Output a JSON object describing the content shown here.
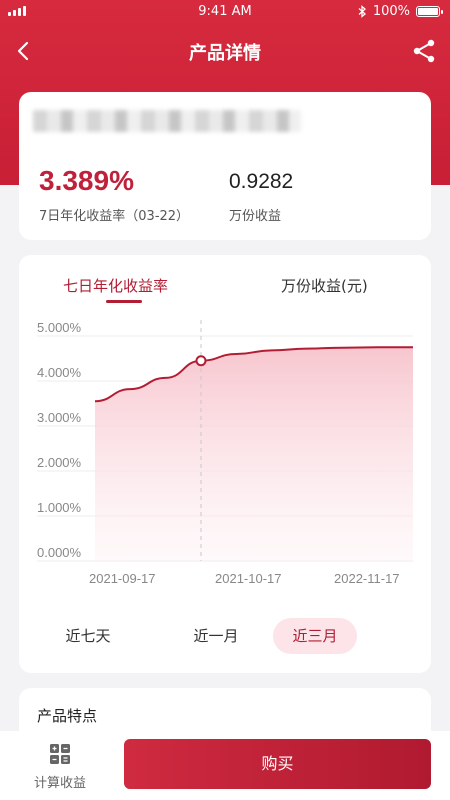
{
  "status_bar": {
    "time": "9:41 AM",
    "battery": "100%"
  },
  "nav": {
    "title": "产品详情"
  },
  "product": {
    "yield_value": "3.389%",
    "yield_label": "7日年化收益率（03-22）",
    "wan_value": "0.9282",
    "wan_label": "万份收益"
  },
  "tabs": [
    {
      "label": "七日年化收益率",
      "active": true
    },
    {
      "label": "万份收益(元)",
      "active": false
    }
  ],
  "chart_data": {
    "type": "area",
    "x_tick_labels": [
      "2021-09-17",
      "2021-10-17",
      "2022-11-17"
    ],
    "y_tick_labels": [
      "5.000%",
      "4.000%",
      "3.000%",
      "2.000%",
      "1.000%",
      "0.000%"
    ],
    "ylim": [
      0,
      5
    ],
    "grid": true,
    "highlight_index": 3,
    "series": [
      {
        "values": [
          3.55,
          3.82,
          4.07,
          4.45,
          4.6,
          4.68,
          4.72,
          4.74,
          4.75,
          4.75
        ]
      }
    ],
    "colors": {
      "line": "#b21d33",
      "fill": "#f7c3cc"
    }
  },
  "ranges": [
    {
      "label": "近七天",
      "active": false
    },
    {
      "label": "近一月",
      "active": false
    },
    {
      "label": "近三月",
      "active": true
    }
  ],
  "features": {
    "title": "产品特点"
  },
  "bottom": {
    "calc_label": "计算收益",
    "buy_label": "购买"
  },
  "colors": {
    "brand": "#c81f36",
    "accent_light": "#fde4e8"
  }
}
